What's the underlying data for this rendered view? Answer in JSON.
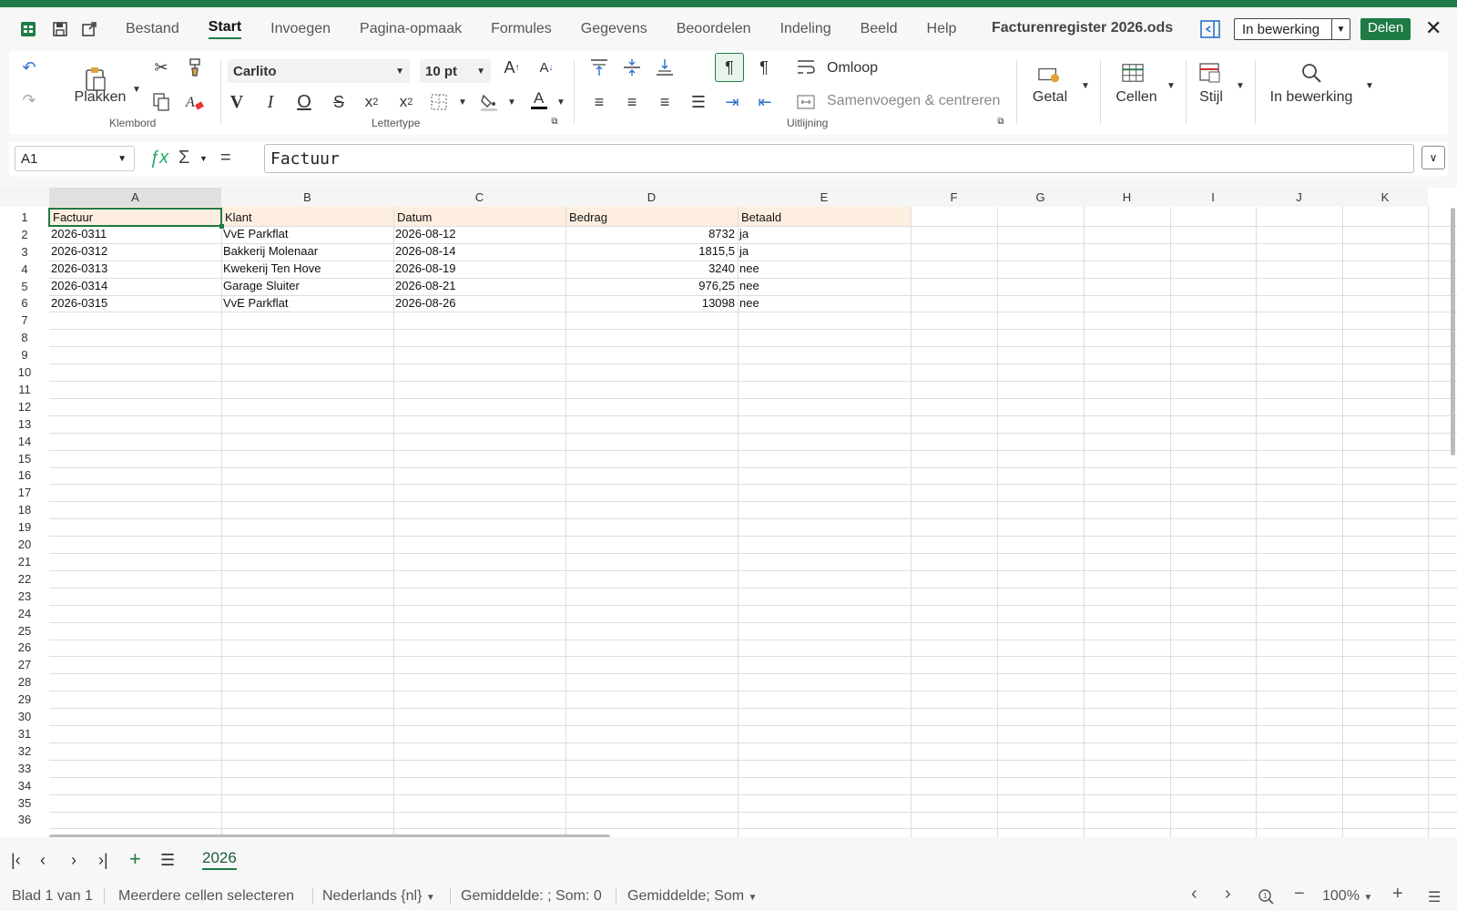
{
  "app": {
    "document_title": "Facturenregister 2026.ods",
    "edit_mode": "In bewerking",
    "share_label": "Delen"
  },
  "menu": {
    "tabs": [
      "Bestand",
      "Start",
      "Invoegen",
      "Pagina-opmaak",
      "Formules",
      "Gegevens",
      "Beoordelen",
      "Indeling",
      "Beeld",
      "Help"
    ],
    "active_tab": "Start"
  },
  "ribbon": {
    "paste_label": "Plakken",
    "clipboard_group": "Klembord",
    "font_name": "Carlito",
    "font_size": "10 pt",
    "font_group": "Lettertype",
    "bold_label": "V",
    "italic_label": "I",
    "underline_label": "O",
    "wrap_label": "Omloop",
    "merge_label": "Samenvoegen & centreren",
    "alignment_group": "Uitlijning",
    "number_label": "Getal",
    "cells_label": "Cellen",
    "style_label": "Stijl",
    "find_label": "In bewerking"
  },
  "formula_bar": {
    "cell_ref": "A1",
    "content": "Factuur"
  },
  "sheet": {
    "columns": [
      "A",
      "B",
      "C",
      "D",
      "E",
      "F",
      "G",
      "H",
      "I",
      "J",
      "K"
    ],
    "rows": [
      "1",
      "2",
      "3",
      "4",
      "5",
      "6",
      "7",
      "8",
      "9",
      "10",
      "11",
      "12",
      "13",
      "14",
      "15",
      "16",
      "17",
      "18",
      "19",
      "20",
      "21",
      "22",
      "23",
      "24",
      "25",
      "26",
      "27",
      "28",
      "29",
      "30",
      "31",
      "32",
      "33",
      "34",
      "35",
      "36"
    ],
    "header": [
      "Factuur",
      "Klant",
      "Datum",
      "Bedrag",
      "Betaald"
    ],
    "data": [
      [
        "2026-0311",
        "VvE Parkflat",
        "2026-08-12",
        "8732",
        "ja"
      ],
      [
        "2026-0312",
        "Bakkerij Molenaar",
        "2026-08-14",
        "1815,5",
        "ja"
      ],
      [
        "2026-0313",
        "Kwekerij Ten Hove",
        "2026-08-19",
        "3240",
        "nee"
      ],
      [
        "2026-0314",
        "Garage Sluiter",
        "2026-08-21",
        "976,25",
        "nee"
      ],
      [
        "2026-0315",
        "VvE Parkflat",
        "2026-08-26",
        "13098",
        "nee"
      ]
    ]
  },
  "sheet_tabs": {
    "active": "2026"
  },
  "status": {
    "sheet_position": "Blad 1 van 1",
    "selection_mode": "Meerdere cellen selecteren",
    "language": "Nederlands {nl}",
    "summary": "Gemiddelde: ; Som: 0",
    "summary_selector": "Gemiddelde; Som",
    "zoom": "100%"
  }
}
